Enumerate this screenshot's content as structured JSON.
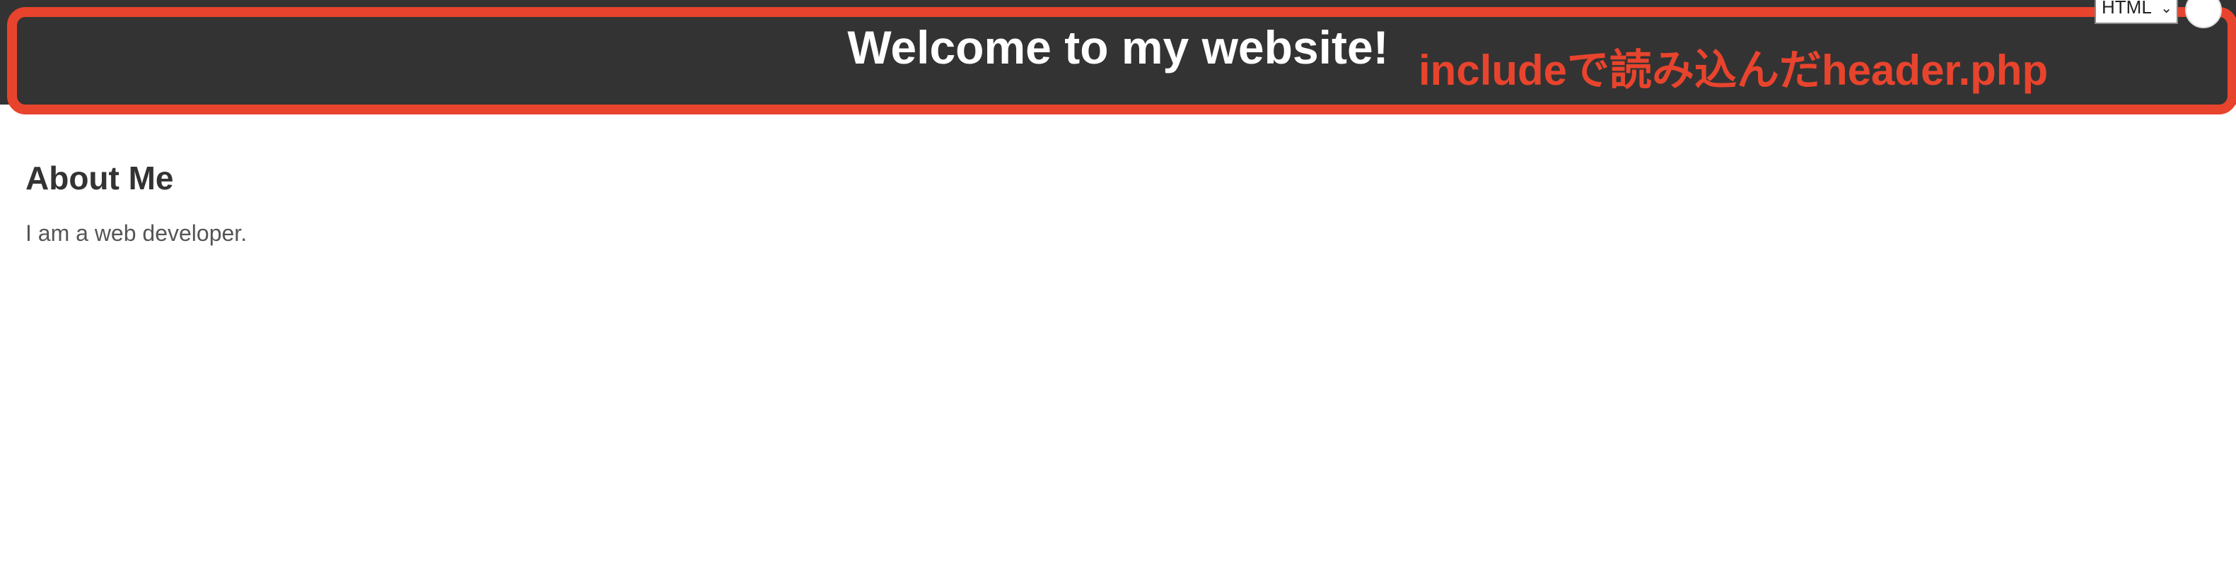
{
  "header": {
    "title": "Welcome to my website!",
    "background": "#333333"
  },
  "annotation": {
    "label": "includeで読み込んだheader.php",
    "color": "#e8442d"
  },
  "controls": {
    "language_value": "HTML",
    "language_chevron": "chevron-down-icon"
  },
  "about": {
    "heading": "About Me",
    "text": "I am a web developer."
  }
}
